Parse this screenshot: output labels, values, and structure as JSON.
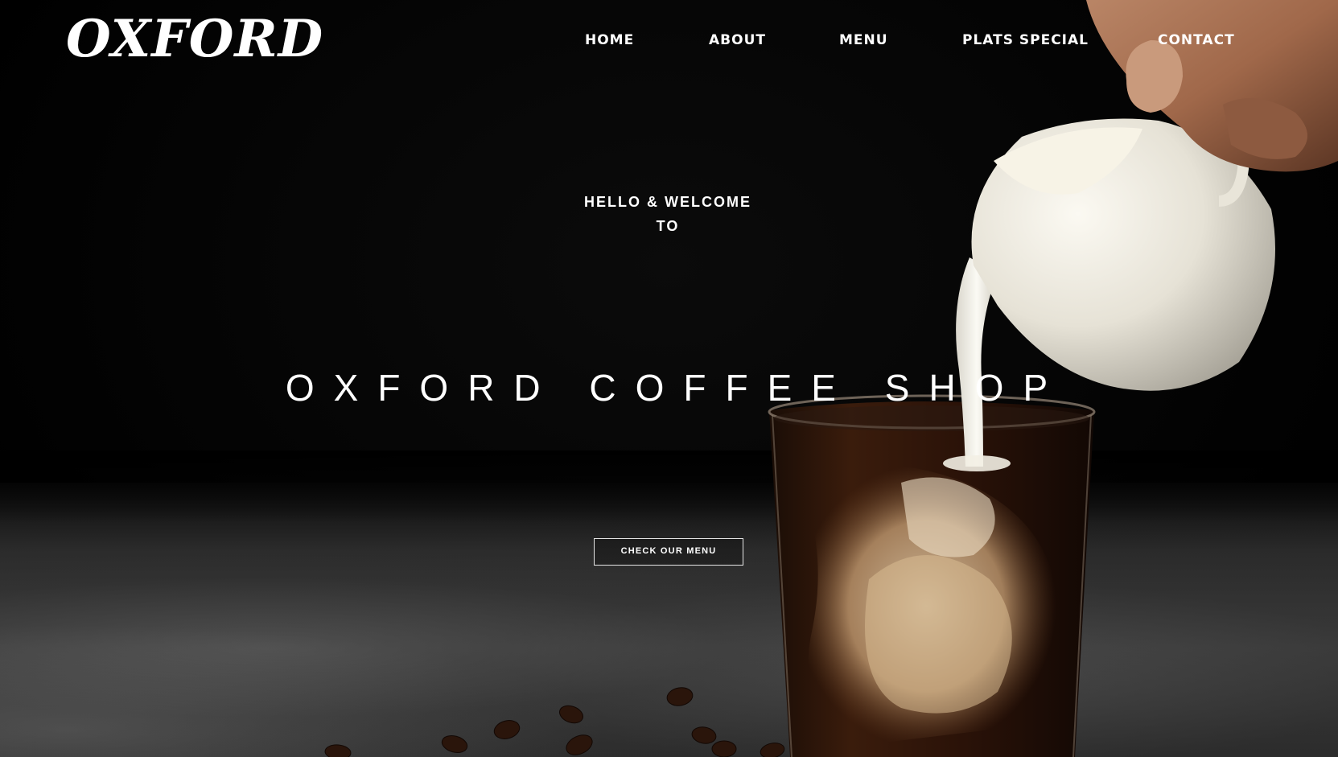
{
  "brand": {
    "logo_text": "OXFORD"
  },
  "nav": {
    "items": [
      {
        "label": "HOME"
      },
      {
        "label": "ABOUT"
      },
      {
        "label": "MENU"
      },
      {
        "label": "PLATS SPECIAL"
      },
      {
        "label": "CONTACT"
      }
    ]
  },
  "hero": {
    "welcome_line1": "HELLO & WELCOME",
    "welcome_line2": "TO",
    "title": "OXFORD COFFEE SHOP",
    "cta_label": "CHECK OUR MENU",
    "image_description_icon": "coffee-milk-pour-photo"
  },
  "colors": {
    "background": "#000000",
    "text": "#ffffff",
    "cta_border": "#e6e6e6"
  }
}
